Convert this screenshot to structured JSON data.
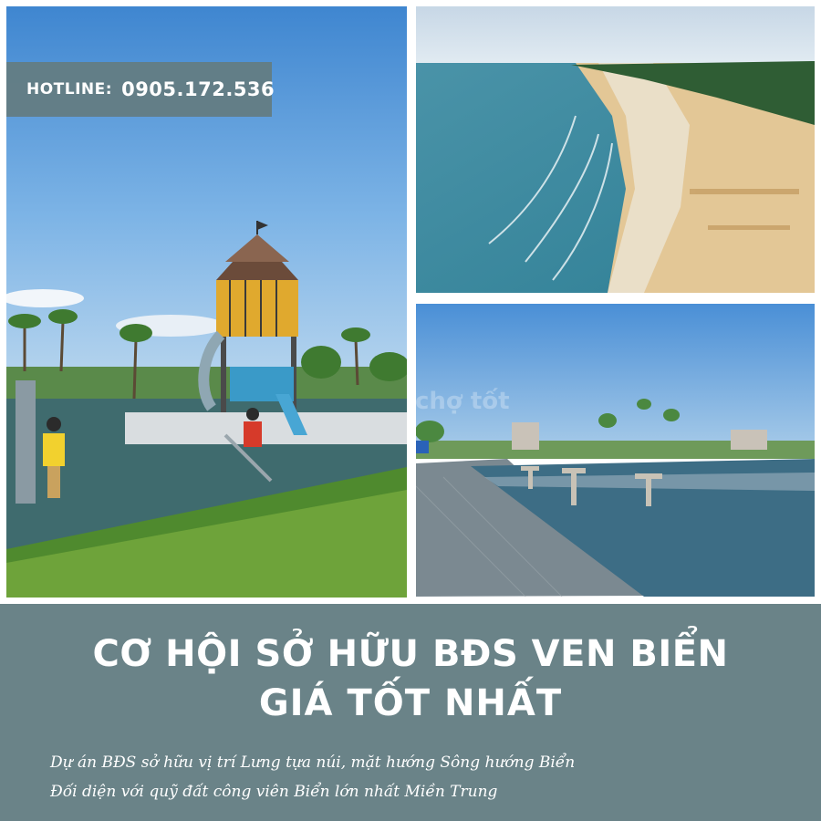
{
  "hotline": {
    "label": "HOTLINE:",
    "number": "0905.172.536"
  },
  "headline": {
    "line1": "CƠ HỘI SỞ HỮU BĐS VEN BIỂN",
    "line2": "GIÁ TỐT NHẤT"
  },
  "description": {
    "line1": "Dự án BĐS sở hữu vị trí Lưng tựa núi, mặt hướng Sông hướng Biển",
    "line2": "Đối diện với quỹ đất công viên Biển lớn nhất Miền Trung"
  },
  "watermark": "chợ tốt",
  "colors": {
    "background": "#6a8388",
    "frame": "#ffffff",
    "text": "#ffffff"
  }
}
